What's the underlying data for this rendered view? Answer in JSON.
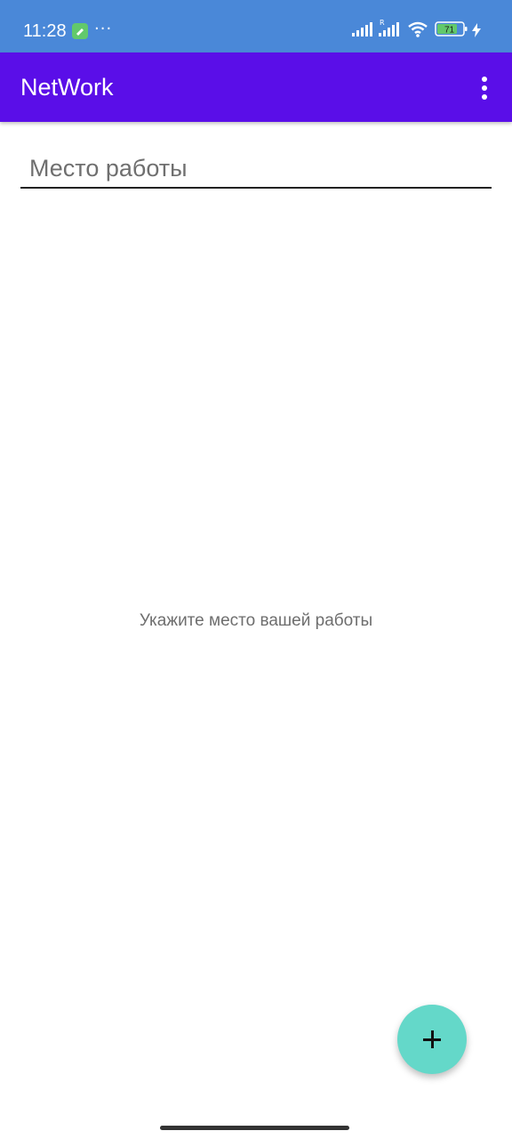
{
  "status_bar": {
    "time": "11:28",
    "dots": "···",
    "battery_level": "71",
    "icons": [
      "notification-app-icon",
      "signal-icon",
      "signal-roaming-icon",
      "wifi-icon",
      "battery-icon",
      "charging-icon"
    ],
    "background_color": "#4a88d8"
  },
  "app_bar": {
    "title": "NetWork",
    "menu_icon": "overflow-menu-icon",
    "background_color": "#5a0ee8"
  },
  "workplace_input": {
    "placeholder": "Место работы",
    "value": ""
  },
  "empty_state": {
    "message": "Укажите место вашей работы"
  },
  "fab": {
    "icon": "add-icon",
    "color": "#64d8c9"
  }
}
